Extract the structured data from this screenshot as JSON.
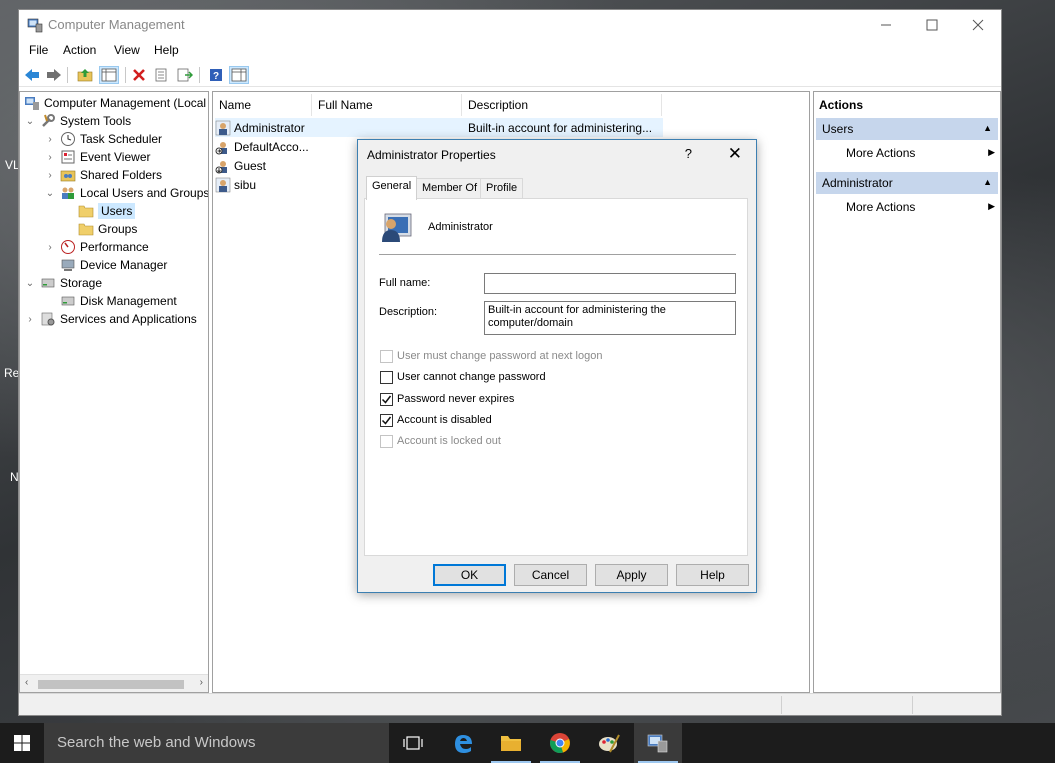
{
  "window": {
    "title": "Computer Management",
    "controls": {
      "minimize": "—",
      "maximize": "☐",
      "close": "✕"
    }
  },
  "menu": [
    "File",
    "Action",
    "View",
    "Help"
  ],
  "toolbar_icons": [
    "back-arrow-icon",
    "forward-arrow-icon",
    "up-folder-icon",
    "show-hide-console-tree-icon",
    "delete-icon",
    "properties-icon",
    "export-list-icon",
    "help-icon",
    "show-hide-action-pane-icon"
  ],
  "tree": {
    "root": "Computer Management (Local",
    "items": [
      {
        "label": "System Tools"
      },
      {
        "label": "Task Scheduler"
      },
      {
        "label": "Event Viewer"
      },
      {
        "label": "Shared Folders"
      },
      {
        "label": "Local Users and Groups"
      },
      {
        "label": "Users"
      },
      {
        "label": "Groups"
      },
      {
        "label": "Performance"
      },
      {
        "label": "Device Manager"
      },
      {
        "label": "Storage"
      },
      {
        "label": "Disk Management"
      },
      {
        "label": "Services and Applications"
      }
    ]
  },
  "list": {
    "columns": [
      "Name",
      "Full Name",
      "Description"
    ],
    "rows": [
      {
        "name": "Administrator",
        "full_name": "",
        "description": "Built-in account for administering..."
      },
      {
        "name": "DefaultAcco...",
        "full_name": "",
        "description": ""
      },
      {
        "name": "Guest",
        "full_name": "",
        "description": ""
      },
      {
        "name": "sibu",
        "full_name": "",
        "description": ""
      }
    ]
  },
  "actions": {
    "title": "Actions",
    "sections": [
      {
        "header": "Users",
        "item": "More Actions"
      },
      {
        "header": "Administrator",
        "item": "More Actions"
      }
    ]
  },
  "dialog": {
    "title": "Administrator Properties",
    "help": "?",
    "close": "✕",
    "tabs": [
      "General",
      "Member Of",
      "Profile"
    ],
    "username": "Administrator",
    "full_name_label": "Full name:",
    "full_name_value": "",
    "description_label": "Description:",
    "description_value": "Built-in account for administering the computer/domain",
    "checkboxes": [
      {
        "label": "User must change password at next logon",
        "checked": false,
        "enabled": false
      },
      {
        "label": "User cannot change password",
        "checked": false,
        "enabled": true
      },
      {
        "label": "Password never expires",
        "checked": true,
        "enabled": true
      },
      {
        "label": "Account is disabled",
        "checked": true,
        "enabled": true
      },
      {
        "label": "Account is locked out",
        "checked": false,
        "enabled": false
      }
    ],
    "buttons": {
      "ok": "OK",
      "cancel": "Cancel",
      "apply": "Apply",
      "help": "Help"
    }
  },
  "desktop_fragments": [
    "VL",
    "Re",
    "N"
  ],
  "taskbar": {
    "search_placeholder": "Search the web and Windows",
    "apps": [
      "task-view-icon",
      "edge-icon",
      "file-explorer-icon",
      "chrome-icon",
      "paint-icon",
      "computer-management-icon"
    ]
  },
  "colors": {
    "selection": "#cce8ff",
    "action_header": "#c6d6ec",
    "taskbar": "#1c1c1c",
    "accent": "#0078d7"
  }
}
